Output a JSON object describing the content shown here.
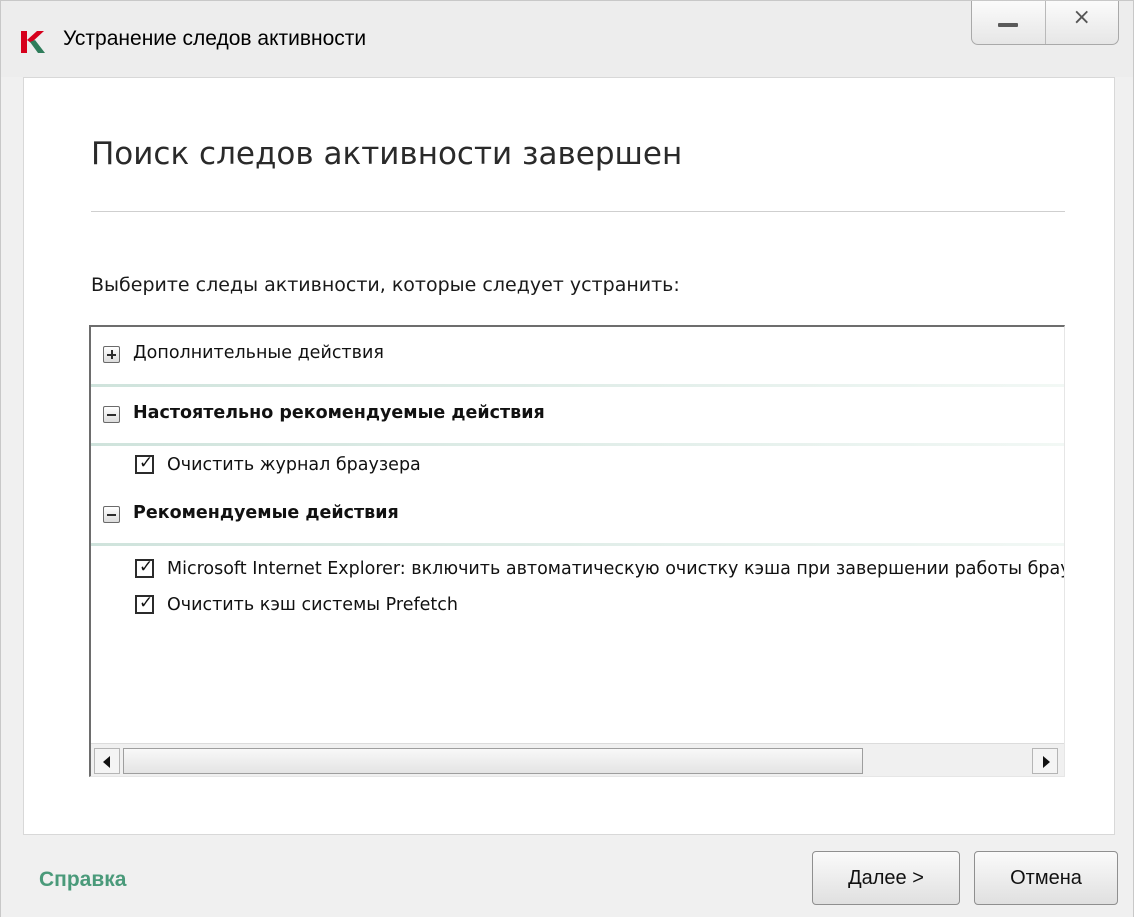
{
  "window": {
    "title": "Устранение следов активности",
    "controls": {
      "minimize": "—",
      "close": "×"
    }
  },
  "main": {
    "heading": "Поиск следов активности завершен",
    "instruction": "Выберите следы активности, которые следует устранить:"
  },
  "tree": {
    "groups": [
      {
        "label": "Дополнительные действия",
        "expanded": false,
        "bold": false
      },
      {
        "label": "Настоятельно рекомендуемые действия",
        "expanded": true,
        "bold": true
      },
      {
        "label": "Рекомендуемые действия",
        "expanded": true,
        "bold": true
      }
    ],
    "items": [
      {
        "label": "Очистить журнал браузера",
        "checked": true
      },
      {
        "label": "Microsoft Internet Explorer: включить автоматическую очистку кэша при завершении работы браузера",
        "checked": true
      },
      {
        "label": "Очистить кэш системы Prefetch",
        "checked": true
      }
    ]
  },
  "footer": {
    "help": "Справка",
    "next": "Далее >",
    "cancel": "Отмена"
  },
  "colors": {
    "help_link": "#4a9a7a",
    "accent_red": "#d6001c",
    "separator": "#cfe3dc"
  }
}
